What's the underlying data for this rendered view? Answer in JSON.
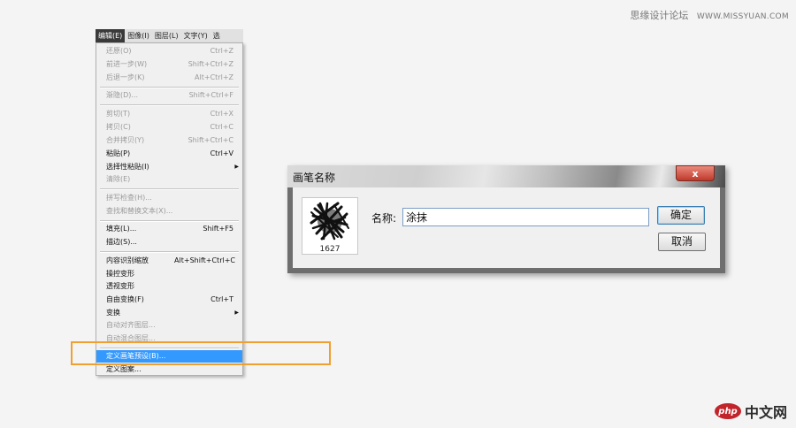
{
  "watermark": {
    "top_text": "思缘设计论坛",
    "top_url": "WWW.MISSYUAN.COM",
    "logo_text": "php",
    "bottom_text": "中文网"
  },
  "menubar": {
    "items": [
      "编辑(E)",
      "图像(I)",
      "图层(L)",
      "文字(Y)",
      "选"
    ]
  },
  "menu": {
    "items": [
      {
        "label": "还原(O)",
        "shortcut": "Ctrl+Z"
      },
      {
        "label": "前进一步(W)",
        "shortcut": "Shift+Ctrl+Z"
      },
      {
        "label": "后退一步(K)",
        "shortcut": "Alt+Ctrl+Z"
      },
      {
        "label": "渐隐(D)...",
        "shortcut": "Shift+Ctrl+F"
      },
      {
        "label": "剪切(T)",
        "shortcut": "Ctrl+X"
      },
      {
        "label": "拷贝(C)",
        "shortcut": "Ctrl+C"
      },
      {
        "label": "合并拷贝(Y)",
        "shortcut": "Shift+Ctrl+C"
      },
      {
        "label": "粘贴(P)",
        "shortcut": "Ctrl+V"
      },
      {
        "label": "选择性粘贴(I)",
        "shortcut": ""
      },
      {
        "label": "清除(E)",
        "shortcut": ""
      },
      {
        "label": "拼写检查(H)...",
        "shortcut": ""
      },
      {
        "label": "查找和替换文本(X)...",
        "shortcut": ""
      },
      {
        "label": "填充(L)...",
        "shortcut": "Shift+F5"
      },
      {
        "label": "描边(S)...",
        "shortcut": ""
      },
      {
        "label": "内容识别缩放",
        "shortcut": "Alt+Shift+Ctrl+C"
      },
      {
        "label": "操控变形",
        "shortcut": ""
      },
      {
        "label": "透视变形",
        "shortcut": ""
      },
      {
        "label": "自由变换(F)",
        "shortcut": "Ctrl+T"
      },
      {
        "label": "变换",
        "shortcut": ""
      },
      {
        "label": "自动对齐图层...",
        "shortcut": ""
      },
      {
        "label": "自动混合图层...",
        "shortcut": ""
      },
      {
        "label": "定义画笔预设(B)...",
        "shortcut": ""
      },
      {
        "label": "定义图案...",
        "shortcut": ""
      }
    ]
  },
  "dialog": {
    "title": "画笔名称",
    "close_label": "x",
    "brush_size": "1627",
    "name_label": "名称:",
    "name_value": "涂抹",
    "ok_label": "确定",
    "cancel_label": "取消"
  }
}
